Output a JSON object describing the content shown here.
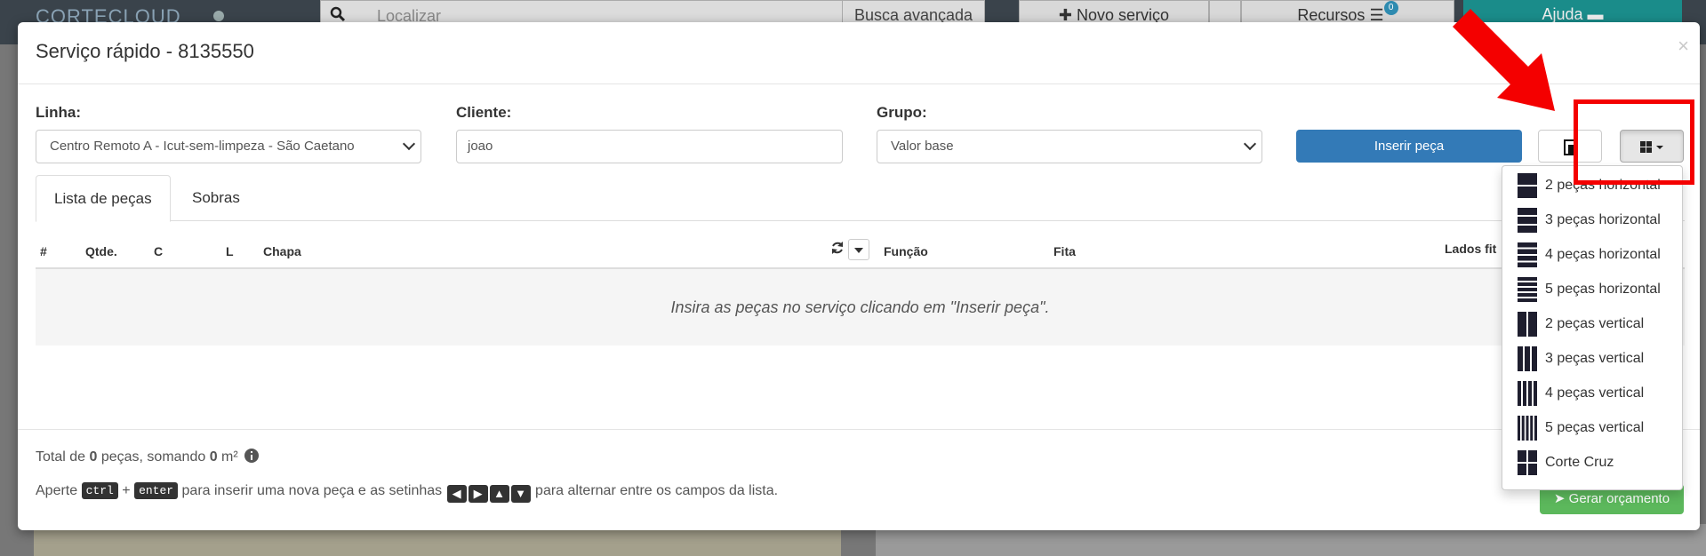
{
  "background": {
    "logo": "CORTECLOUD",
    "search_placeholder": "Localizar",
    "advanced_search": "Busca avançada",
    "new_service": "Novo serviço",
    "resources": "Recursos",
    "resources_badge": "0",
    "help": "Ajuda"
  },
  "modal": {
    "title": "Serviço rápido - 8135550",
    "close": "×",
    "linha_label": "Linha:",
    "linha_value": "Centro Remoto A - Icut-sem-limpeza - São Caetano",
    "cliente_label": "Cliente:",
    "cliente_value": "joao",
    "grupo_label": "Grupo:",
    "grupo_value": "Valor base",
    "insert_button": "Inserir peça",
    "tabs": [
      "Lista de peças",
      "Sobras"
    ],
    "columns": {
      "num": "#",
      "qtde": "Qtde.",
      "c": "C",
      "l": "L",
      "chapa": "Chapa",
      "funcao": "Função",
      "fita": "Fita",
      "lados": "Lados fit"
    },
    "empty_message": "Insira as peças no serviço clicando em \"Inserir peça\".",
    "total_prefix": "Total de ",
    "total_pieces": "0",
    "total_middle": " peças, somando ",
    "total_area": "0",
    "total_unit": " m²",
    "hint_prefix": "Aperte",
    "hint_ctrl": "ctrl",
    "hint_plus": "+",
    "hint_enter": "enter",
    "hint_middle": "para inserir uma nova peça e as setinhas",
    "hint_suffix": "para alternar entre os campos da lista.",
    "generate_button": "Gerar orçamento"
  },
  "dropdown": {
    "items": [
      {
        "label": "2 peças horizontal",
        "icon": "split-2-horizontal-icon"
      },
      {
        "label": "3 peças horizontal",
        "icon": "split-3-horizontal-icon"
      },
      {
        "label": "4 peças horizontal",
        "icon": "split-4-horizontal-icon"
      },
      {
        "label": "5 peças horizontal",
        "icon": "split-5-horizontal-icon"
      },
      {
        "label": "2 peças vertical",
        "icon": "split-2-vertical-icon"
      },
      {
        "label": "3 peças vertical",
        "icon": "split-3-vertical-icon"
      },
      {
        "label": "4 peças vertical",
        "icon": "split-4-vertical-icon"
      },
      {
        "label": "5 peças vertical",
        "icon": "split-5-vertical-icon"
      },
      {
        "label": "Corte Cruz",
        "icon": "cross-cut-icon"
      }
    ]
  },
  "colors": {
    "primary": "#337ab7",
    "success": "#5cb85c",
    "annotation": "#f40000",
    "icon_fill": "#1e1e2e"
  }
}
